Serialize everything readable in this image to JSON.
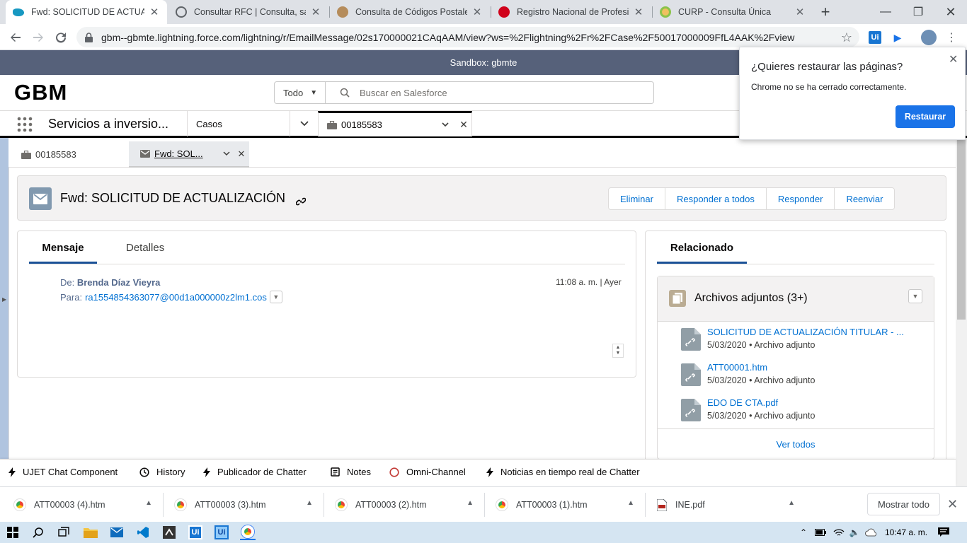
{
  "browser": {
    "tabs": [
      {
        "title": "Fwd: SOLICITUD DE ACTUALIZACIÓN",
        "active": true,
        "favicon_color": "#1798c1"
      },
      {
        "title": "Consultar RFC | Consulta, sacar",
        "active": false,
        "favicon_color": "#5f6368"
      },
      {
        "title": "Consulta de Códigos Postales",
        "active": false,
        "favicon_color": "#b58c5b"
      },
      {
        "title": "Registro Nacional de Profesiones",
        "active": false,
        "favicon_color": "#d0021b"
      },
      {
        "title": "CURP - Consulta Única",
        "active": false,
        "favicon_color": "#8bc34a"
      }
    ],
    "url": "gbm--gbmte.lightning.force.com/lightning/r/EmailMessage/02s170000021CAqAAM/view?ws=%2Flightning%2Fr%2FCase%2F50017000009FfL4AAK%2Fview",
    "extensions": [
      "Ui",
      "▶"
    ]
  },
  "restore_popup": {
    "title": "¿Quieres restaurar las páginas?",
    "message": "Chrome no se ha cerrado correctamente.",
    "button": "Restaurar"
  },
  "salesforce": {
    "sandbox_banner": "Sandbox: gbmte",
    "logo": "GBM",
    "search": {
      "scope": "Todo",
      "placeholder": "Buscar en Salesforce"
    },
    "app_name": "Servicios a inversio...",
    "nav_object": "Casos",
    "nav_tab": "00185583",
    "subtabs": [
      {
        "label": "00185583"
      },
      {
        "label": "Fwd: SOL..."
      }
    ],
    "record": {
      "title": "Fwd: SOLICITUD DE ACTUALIZACIÓN",
      "actions": [
        "Eliminar",
        "Responder a todos",
        "Responder",
        "Reenviar"
      ]
    },
    "message": {
      "tabs": [
        "Mensaje",
        "Detalles"
      ],
      "from_label": "De:",
      "from_name": "Brenda Díaz Vieyra",
      "to_label": "Para:",
      "to_address": "ra1554854363077@00d1a000000z2lm1.cos",
      "time": "11:08 a. m. | Ayer"
    },
    "related": {
      "tab": "Relacionado",
      "attachments_title": "Archivos adjuntos (3+)",
      "files": [
        {
          "name": "SOLICITUD DE ACTUALIZACIÓN TITULAR - ...",
          "date": "5/03/2020",
          "type": "Archivo adjunto"
        },
        {
          "name": "ATT00001.htm",
          "date": "5/03/2020",
          "type": "Archivo adjunto"
        },
        {
          "name": "EDO DE CTA.pdf",
          "date": "5/03/2020",
          "type": "Archivo adjunto"
        }
      ],
      "view_all": "Ver todos",
      "meta_separator": "•"
    },
    "utility_bar": [
      {
        "label": "UJET Chat Component",
        "icon": "bolt-icon"
      },
      {
        "label": "History",
        "icon": "clock-icon"
      },
      {
        "label": "Publicador de Chatter",
        "icon": "bolt-icon"
      },
      {
        "label": "Notes",
        "icon": "notes-icon"
      },
      {
        "label": "Omni-Channel",
        "icon": "omni-icon"
      },
      {
        "label": "Noticias en tiempo real de Chatter",
        "icon": "bolt-icon"
      }
    ]
  },
  "downloads": {
    "items": [
      "ATT00003 (4).htm",
      "ATT00003 (3).htm",
      "ATT00003 (2).htm",
      "ATT00003 (1).htm",
      "INE.pdf"
    ],
    "show_all": "Mostrar todo"
  },
  "taskbar": {
    "clock": "10:47 a. m."
  }
}
